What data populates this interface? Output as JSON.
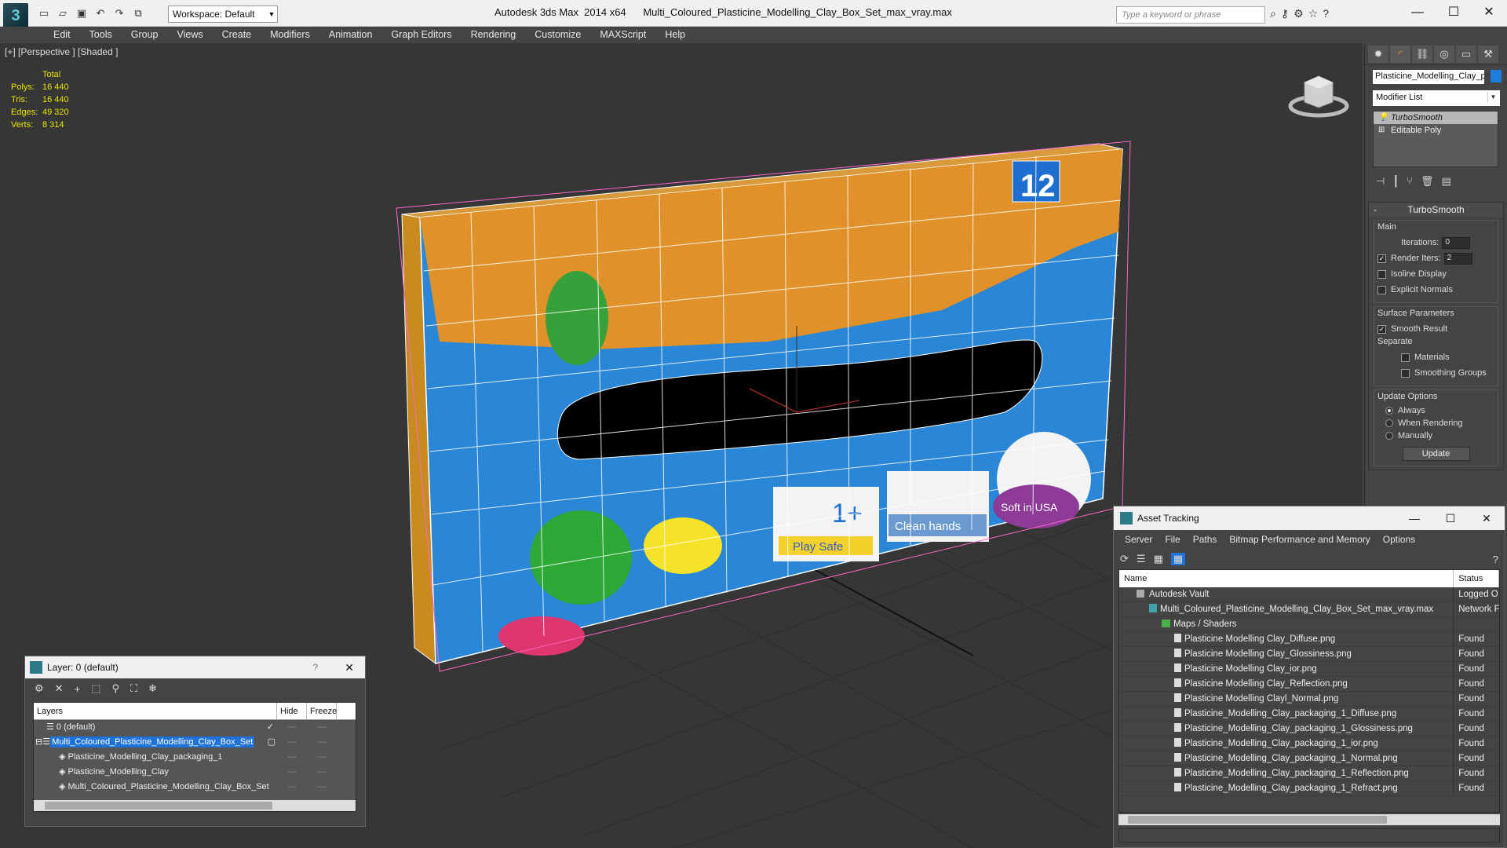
{
  "titlebar": {
    "app_title": "Autodesk 3ds Max  2014 x64",
    "file_title": "Multi_Coloured_Plasticine_Modelling_Clay_Box_Set_max_vray.max",
    "workspace": "Workspace: Default",
    "search_placeholder": "Type a keyword or phrase"
  },
  "menu": [
    "Edit",
    "Tools",
    "Group",
    "Views",
    "Create",
    "Modifiers",
    "Animation",
    "Graph Editors",
    "Rendering",
    "Customize",
    "MAXScript",
    "Help"
  ],
  "viewport": {
    "label": "[+] [Perspective ] [Shaded ]",
    "stats": {
      "header": "Total",
      "rows": [
        {
          "k": "Polys:",
          "v": "16 440"
        },
        {
          "k": "Tris:",
          "v": "16 440"
        },
        {
          "k": "Edges:",
          "v": "49 320"
        },
        {
          "k": "Verts:",
          "v": "8 314"
        }
      ]
    },
    "box_number": "12",
    "badges": [
      "1+",
      "Play Safe",
      "Clean hands",
      "Soft in USA"
    ]
  },
  "command_panel": {
    "object_name": "Plasticine_Modelling_Clay_pa",
    "object_color": "#1e7be0",
    "modifier_list": "Modifier List",
    "stack": [
      {
        "label": "TurboSmooth",
        "selected": true
      },
      {
        "label": "Editable Poly",
        "selected": false
      }
    ],
    "rollout_title": "TurboSmooth",
    "main_group": "Main",
    "iterations_label": "Iterations:",
    "iterations_value": "0",
    "render_iters_label": "Render Iters:",
    "render_iters_value": "2",
    "isoline": "Isoline Display",
    "explicit": "Explicit Normals",
    "surface_group": "Surface Parameters",
    "smooth_result": "Smooth Result",
    "separate": "Separate",
    "materials": "Materials",
    "smoothing_groups": "Smoothing Groups",
    "update_group": "Update Options",
    "always": "Always",
    "when_rendering": "When Rendering",
    "manually": "Manually",
    "update_button": "Update"
  },
  "layer_window": {
    "title": "Layer: 0 (default)",
    "col_layers": "Layers",
    "col_hide": "Hide",
    "col_freeze": "Freeze",
    "rows": [
      {
        "name": "0 (default)",
        "indent": 1,
        "selected": false
      },
      {
        "name": "Multi_Coloured_Plasticine_Modelling_Clay_Box_Set",
        "indent": 0,
        "selected": true
      },
      {
        "name": "Plasticine_Modelling_Clay_packaging_1",
        "indent": 2,
        "selected": false
      },
      {
        "name": "Plasticine_Modelling_Clay",
        "indent": 2,
        "selected": false
      },
      {
        "name": "Multi_Coloured_Plasticine_Modelling_Clay_Box_Set",
        "indent": 2,
        "selected": false
      }
    ]
  },
  "asset_window": {
    "title": "Asset Tracking",
    "menu": [
      "Server",
      "File",
      "Paths",
      "Bitmap Performance and Memory",
      "Options"
    ],
    "col_name": "Name",
    "col_status": "Status",
    "rows": [
      {
        "name": "Autodesk Vault",
        "status": "Logged O",
        "kind": "vault",
        "indent": 1
      },
      {
        "name": "Multi_Coloured_Plasticine_Modelling_Clay_Box_Set_max_vray.max",
        "status": "Network F",
        "kind": "max",
        "indent": 2
      },
      {
        "name": "Maps / Shaders",
        "status": "",
        "kind": "maps",
        "indent": 3
      },
      {
        "name": "Plasticine Modelling Clay_Diffuse.png",
        "status": "Found",
        "kind": "file",
        "indent": 4
      },
      {
        "name": "Plasticine Modelling Clay_Glossiness.png",
        "status": "Found",
        "kind": "file",
        "indent": 4
      },
      {
        "name": "Plasticine Modelling Clay_ior.png",
        "status": "Found",
        "kind": "file",
        "indent": 4
      },
      {
        "name": "Plasticine Modelling Clay_Reflection.png",
        "status": "Found",
        "kind": "file",
        "indent": 4
      },
      {
        "name": "Plasticine Modelling Clayl_Normal.png",
        "status": "Found",
        "kind": "file",
        "indent": 4
      },
      {
        "name": "Plasticine_Modelling_Clay_packaging_1_Diffuse.png",
        "status": "Found",
        "kind": "file",
        "indent": 4
      },
      {
        "name": "Plasticine_Modelling_Clay_packaging_1_Glossiness.png",
        "status": "Found",
        "kind": "file",
        "indent": 4
      },
      {
        "name": "Plasticine_Modelling_Clay_packaging_1_ior.png",
        "status": "Found",
        "kind": "file",
        "indent": 4
      },
      {
        "name": "Plasticine_Modelling_Clay_packaging_1_Normal.png",
        "status": "Found",
        "kind": "file",
        "indent": 4
      },
      {
        "name": "Plasticine_Modelling_Clay_packaging_1_Reflection.png",
        "status": "Found",
        "kind": "file",
        "indent": 4
      },
      {
        "name": "Plasticine_Modelling_Clay_packaging_1_Refract.png",
        "status": "Found",
        "kind": "file",
        "indent": 4
      }
    ]
  }
}
